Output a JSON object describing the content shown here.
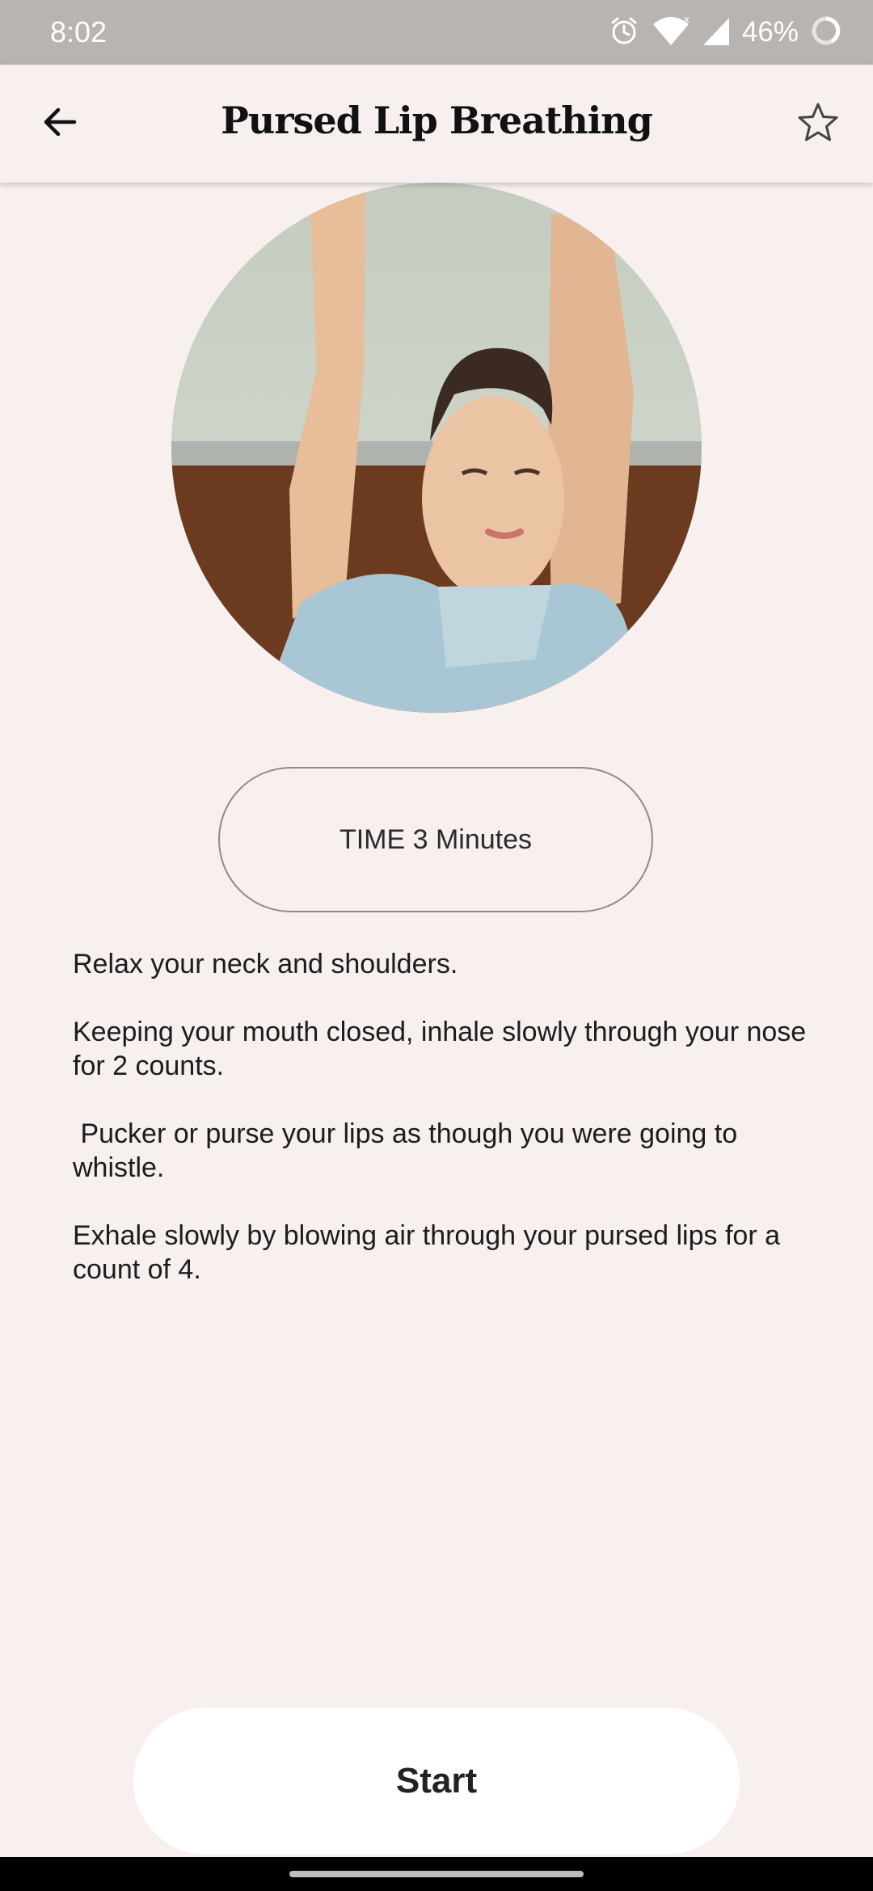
{
  "status_bar": {
    "time": "8:02",
    "battery": "46%",
    "icons": [
      "alarm-icon",
      "wifi-icon",
      "signal-icon",
      "battery-icon"
    ]
  },
  "appbar": {
    "title": "Pursed Lip Breathing",
    "back_icon": "arrow-left-icon",
    "favorite_icon": "star-outline-icon"
  },
  "duration": {
    "label": "TIME 3 Minutes"
  },
  "instructions": [
    "Relax your neck and shoulders.",
    "Keeping your mouth closed, inhale slowly through your nose for 2 counts.",
    " Pucker or purse your lips as though you were going to whistle.",
    "Exhale slowly by blowing air through your pursed lips for a count of 4."
  ],
  "start_button": {
    "label": "Start"
  },
  "colors": {
    "background": "#f7f0ee",
    "status_bar": "#b8b4b1",
    "button": "#ffffff",
    "pill_border": "#8f8a88"
  }
}
